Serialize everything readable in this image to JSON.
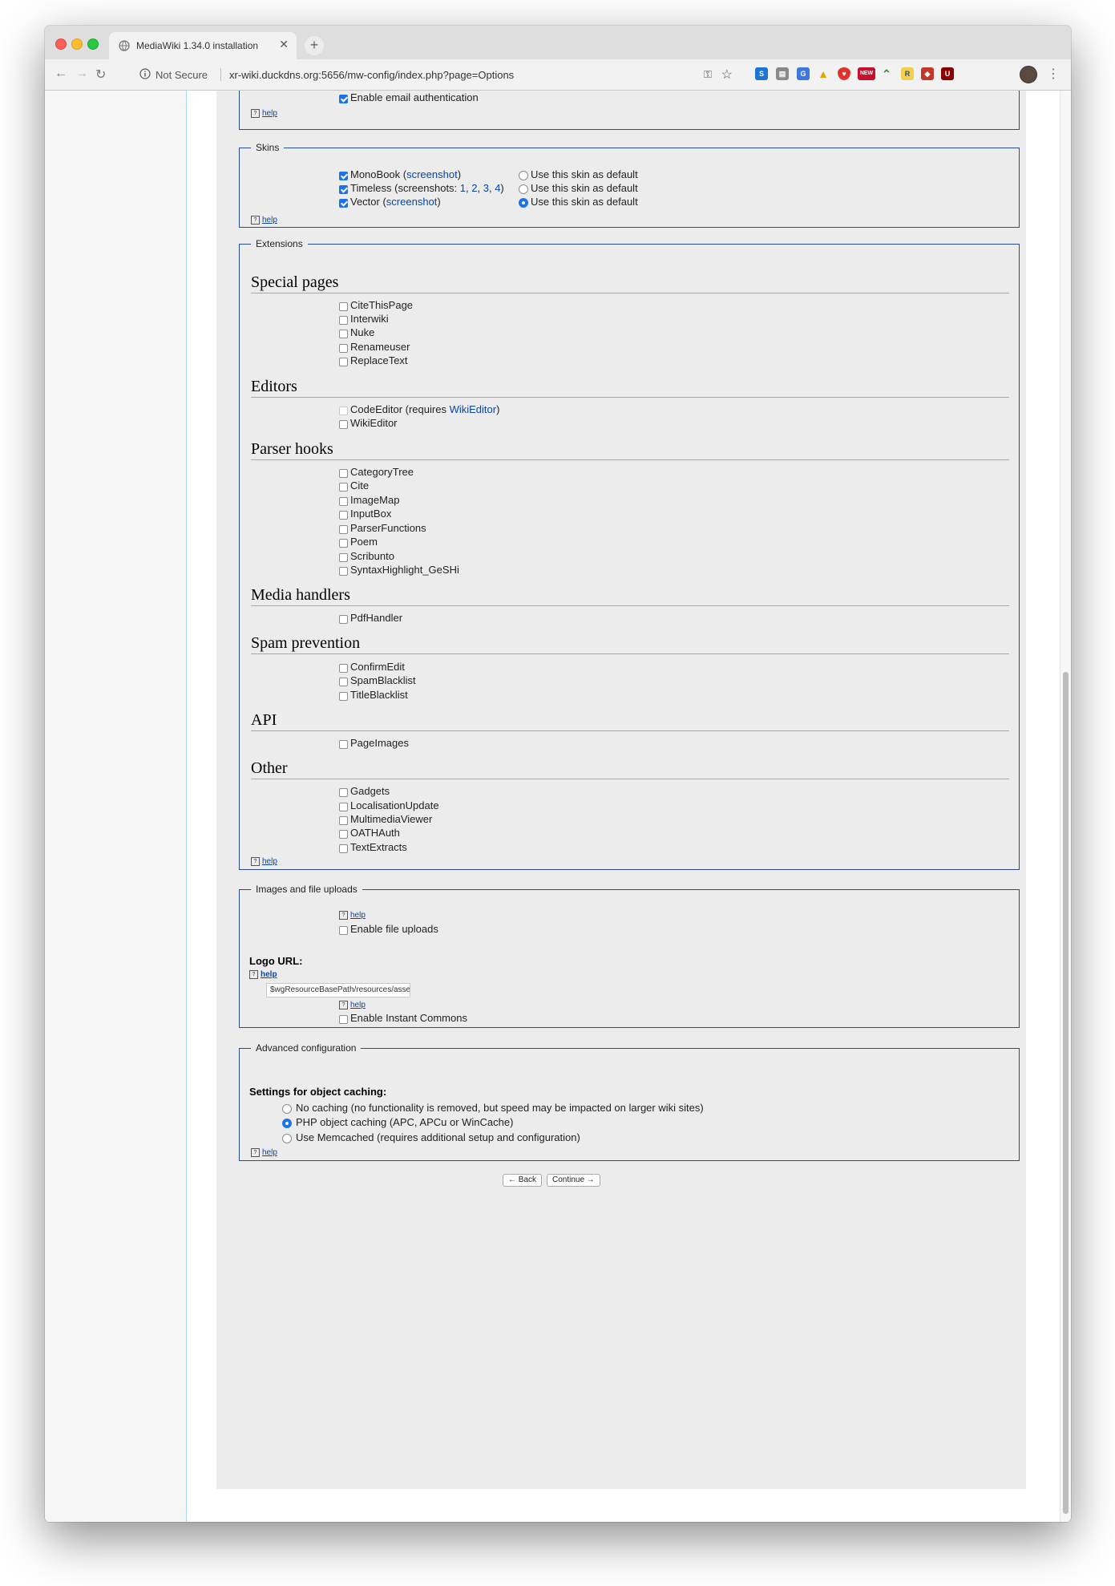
{
  "browser": {
    "tab_title": "MediaWiki 1.34.0 installation",
    "security_label": "Not Secure",
    "url": "xr-wiki.duckdns.org:5656/mw-config/index.php?page=Options",
    "ext_new_badge": "NEW"
  },
  "email": {
    "auth_label": "Enable email authentication",
    "help": "help"
  },
  "skins": {
    "legend": "Skins",
    "items": [
      {
        "pre": "MonoBook (",
        "link": "screenshot",
        "post": ")",
        "checked": true,
        "default": false,
        "default_label": "Use this skin as default"
      },
      {
        "pre": "Timeless (screenshots: ",
        "links": [
          "1",
          "2",
          "3",
          "4"
        ],
        "post": ")",
        "checked": true,
        "default": false,
        "default_label": "Use this skin as default"
      },
      {
        "pre": "Vector (",
        "link": "screenshot",
        "post": ")",
        "checked": true,
        "default": true,
        "default_label": "Use this skin as default"
      }
    ],
    "help": "help"
  },
  "extensions": {
    "legend": "Extensions",
    "sections": {
      "special_pages": {
        "title": "Special pages",
        "items": [
          "CiteThisPage",
          "Interwiki",
          "Nuke",
          "Renameuser",
          "ReplaceText"
        ]
      },
      "editors": {
        "title": "Editors",
        "code_editor_pre": "CodeEditor (requires ",
        "code_editor_link": "WikiEditor",
        "code_editor_post": ")",
        "wiki_editor": "WikiEditor"
      },
      "parser_hooks": {
        "title": "Parser hooks",
        "items": [
          "CategoryTree",
          "Cite",
          "ImageMap",
          "InputBox",
          "ParserFunctions",
          "Poem",
          "Scribunto",
          "SyntaxHighlight_GeSHi"
        ]
      },
      "media_handlers": {
        "title": "Media handlers",
        "items": [
          "PdfHandler"
        ]
      },
      "spam_prevention": {
        "title": "Spam prevention",
        "items": [
          "ConfirmEdit",
          "SpamBlacklist",
          "TitleBlacklist"
        ]
      },
      "api": {
        "title": "API",
        "items": [
          "PageImages"
        ]
      },
      "other": {
        "title": "Other",
        "items": [
          "Gadgets",
          "LocalisationUpdate",
          "MultimediaViewer",
          "OATHAuth",
          "TextExtracts"
        ]
      }
    },
    "help": "help"
  },
  "uploads": {
    "legend": "Images and file uploads",
    "help1": "help",
    "enable_uploads": "Enable file uploads",
    "logo_label": "Logo URL:",
    "logo_help": "help",
    "logo_value": "$wgResourceBasePath/resources/assets/w",
    "help2": "help",
    "instant_commons": "Enable Instant Commons"
  },
  "advanced": {
    "legend": "Advanced configuration",
    "caching_label": "Settings for object caching:",
    "options": [
      {
        "label": "No caching (no functionality is removed, but speed may be impacted on larger wiki sites)",
        "selected": false
      },
      {
        "label": "PHP object caching (APC, APCu or WinCache)",
        "selected": true
      },
      {
        "label": "Use Memcached (requires additional setup and configuration)",
        "selected": false
      }
    ],
    "help": "help"
  },
  "buttons": {
    "back": "← Back",
    "continue": "Continue →"
  }
}
